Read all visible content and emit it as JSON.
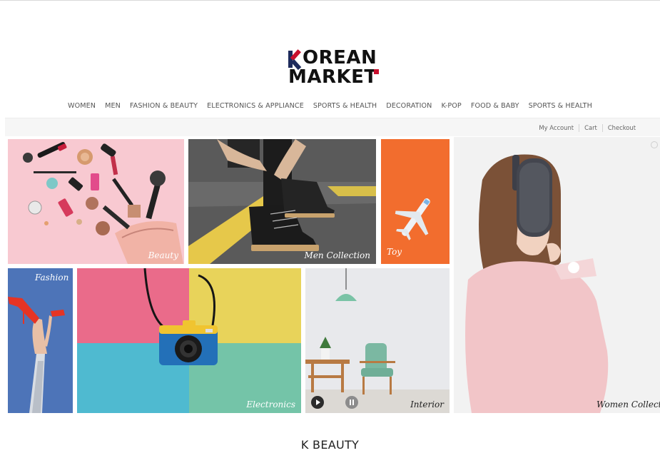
{
  "brand": {
    "line1": "OREAN",
    "line1_initial": "K",
    "line2": "MARKET",
    "colors": {
      "navy": "#1e2b5c",
      "red": "#c8102e"
    }
  },
  "nav": {
    "items": [
      "WOMEN",
      "MEN",
      "FASHION & BEAUTY",
      "ELECTRONICS & APPLIANCE",
      "SPORTS & HEALTH",
      "DECORATION",
      "K-POP",
      "FOOD & BABY",
      "SPORTS & HEALTH"
    ]
  },
  "account": {
    "my_account": "My Account",
    "cart": "Cart",
    "checkout": "Checkout"
  },
  "tiles": {
    "beauty": "Beauty",
    "men": "Men Collection",
    "toy": "Toy",
    "fashion": "Fashion",
    "electronics": "Electronics",
    "interior": "Interior",
    "women": "Women Collection"
  },
  "section": {
    "title": "K BEAUTY"
  },
  "icons": {
    "play": "play-icon",
    "pause": "pause-icon"
  }
}
